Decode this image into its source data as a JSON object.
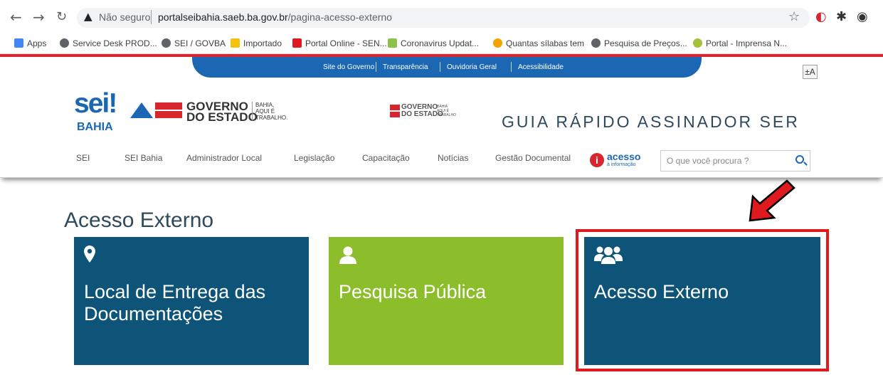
{
  "browser": {
    "not_secure": "Não seguro",
    "url_host": "portalseibahia.saeb.ba.gov.br",
    "url_path": "/pagina-acesso-externo"
  },
  "bookmarks": [
    {
      "label": "Apps",
      "color": "#4285f4"
    },
    {
      "label": "Service Desk PROD...",
      "color": "#5f6368"
    },
    {
      "label": "SEI / GOVBA",
      "color": "#5f6368"
    },
    {
      "label": "Importado",
      "color": "#f4c20d"
    },
    {
      "label": "Portal Online - SEN...",
      "color": "#e0191f"
    },
    {
      "label": "Coronavirus Updat...",
      "color": "#8bc34a"
    },
    {
      "label": "Quantas sílabas tem",
      "color": "#f4a300"
    },
    {
      "label": "Pesquisa de Preços...",
      "color": "#5f6368"
    },
    {
      "label": "Portal - Imprensa N...",
      "color": "#a3c23a"
    }
  ],
  "topnav": [
    "Site do Governo",
    "Transparência",
    "Ouvidoria Geral",
    "Acessibilidade"
  ],
  "a11y_label": "±A",
  "logo": {
    "sei": "sei!",
    "bahia": "BAHIA",
    "gov_line1": "GOVERNO",
    "gov_line2": "DO ESTADO",
    "gov_sub1": "BAHIA,",
    "gov_sub2": "AQUI É",
    "gov_sub3": "TRABALHO.",
    "gov2_line1": "GOVERNO",
    "gov2_line2": "DO ESTADO",
    "gov2_sub1": "BAHIA",
    "gov2_sub2": "AQUI É",
    "gov2_sub3": "TRABALHO"
  },
  "banner": "GUIA RÁPIDO ASSINADOR SER",
  "menu": [
    "SEI",
    "SEI Bahia",
    "Administrador Local",
    "Legislação",
    "Capacitação",
    "Notícias",
    "Gestão Documental"
  ],
  "acesso_info": {
    "icon": "i",
    "title": "acesso",
    "subtitle": "à informação"
  },
  "search": {
    "placeholder": "O que você procura ?"
  },
  "page_title": "Acesso Externo",
  "tiles": [
    {
      "line1": "Local de Entrega das",
      "line2": "Documentações",
      "color": "#0d5478",
      "icon": "map-pin-icon"
    },
    {
      "line1": "Pesquisa Pública",
      "line2": "",
      "color": "#8cbd2a",
      "icon": "user-icon"
    },
    {
      "line1": "Acesso Externo",
      "line2": "",
      "color": "#0d5478",
      "icon": "users-icon"
    }
  ]
}
